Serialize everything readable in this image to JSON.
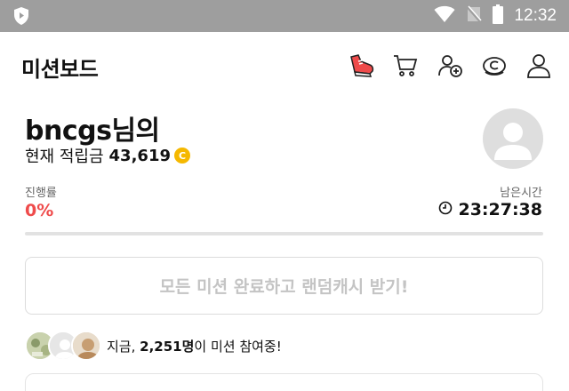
{
  "status_bar": {
    "time": "12:32",
    "icons": [
      "shield-icon",
      "wifi-icon",
      "no-signal-icon",
      "battery-icon"
    ]
  },
  "app_bar": {
    "title": "미션보드",
    "icons": [
      "shoe-icon",
      "cart-icon",
      "add-friend-icon",
      "coin-icon",
      "profile-icon"
    ]
  },
  "user": {
    "name": "bncgs님의",
    "points_label": "현재 적립금",
    "points_value": "43,619",
    "coin_symbol": "C"
  },
  "progress": {
    "label": "진행률",
    "value": "0%",
    "fraction": 0
  },
  "remaining": {
    "label": "남은시간",
    "time": "23:27:38"
  },
  "cta": {
    "label": "모든 미션 완료하고 랜덤캐시 받기!"
  },
  "participants": {
    "prefix": "지금, ",
    "count": "2,251명",
    "suffix": "이 미션 참여중!"
  },
  "colors": {
    "accent": "#ef4b4b",
    "coin": "#f5b800",
    "status_bar": "#9e9e9e"
  }
}
